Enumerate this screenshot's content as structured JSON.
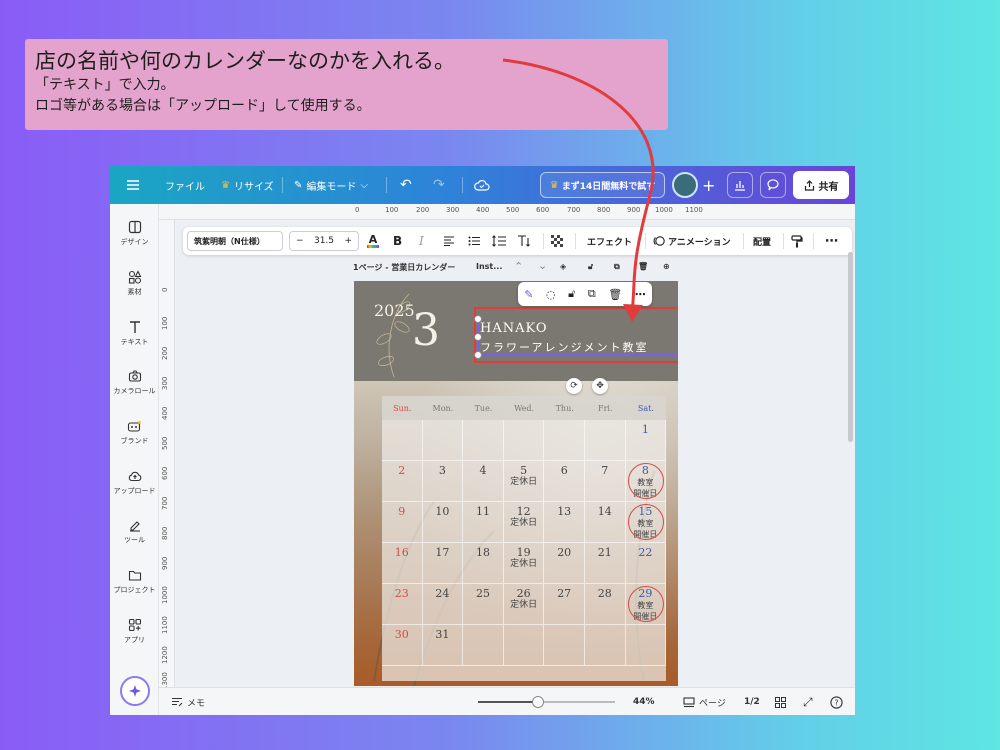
{
  "note": {
    "line1": "店の名前や何のカレンダーなのかを入れる。",
    "line2": "「テキスト」で入力。",
    "line3": "ロゴ等がある場合は「アップロード」して使用する。"
  },
  "topbar": {
    "file": "ファイル",
    "resize": "リサイズ",
    "edit_mode": "編集モード",
    "trial": "まず14日間無料で試す",
    "share": "共有"
  },
  "sidebar": {
    "items": [
      {
        "label": "デザイン",
        "icon": "design-icon"
      },
      {
        "label": "素材",
        "icon": "elements-icon"
      },
      {
        "label": "テキスト",
        "icon": "text-icon"
      },
      {
        "label": "カメラロール",
        "icon": "camera-icon"
      },
      {
        "label": "ブランド",
        "icon": "brand-icon"
      },
      {
        "label": "アップロード",
        "icon": "upload-icon"
      },
      {
        "label": "ツール",
        "icon": "draw-icon"
      },
      {
        "label": "プロジェクト",
        "icon": "folder-icon"
      },
      {
        "label": "アプリ",
        "icon": "apps-icon"
      }
    ]
  },
  "ruler": {
    "top": [
      "0",
      "100",
      "200",
      "300",
      "400",
      "500",
      "600",
      "700",
      "800",
      "900",
      "1000",
      "1100"
    ],
    "left": [
      "0",
      "100",
      "200",
      "300",
      "400",
      "500",
      "600",
      "700",
      "800",
      "900",
      "1000",
      "1100",
      "1200",
      "1300"
    ]
  },
  "text_toolbar": {
    "font": "筑紫明朝（N仕様）",
    "size": "31.5",
    "effect": "エフェクト",
    "animation": "アニメーション",
    "arrange": "配置"
  },
  "pagebar": {
    "title": "1ページ - 営業日カレンダー",
    "suffix": "Inst..."
  },
  "calendar": {
    "year": "2025",
    "month": "3",
    "shop_name": "HANAKO",
    "shop_desc": "フラワーアレンジメント教室",
    "weekdays": [
      "Sun.",
      "Mon.",
      "Tue.",
      "Wed.",
      "Thu.",
      "Fri.",
      "Sat."
    ],
    "weeks": [
      [
        {
          "d": ""
        },
        {
          "d": ""
        },
        {
          "d": ""
        },
        {
          "d": ""
        },
        {
          "d": ""
        },
        {
          "d": ""
        },
        {
          "d": "1"
        }
      ],
      [
        {
          "d": "2"
        },
        {
          "d": "3"
        },
        {
          "d": "4"
        },
        {
          "d": "5",
          "note": "定休日"
        },
        {
          "d": "6"
        },
        {
          "d": "7"
        },
        {
          "d": "8",
          "note": "教室",
          "note2": "開催日",
          "circle": true
        }
      ],
      [
        {
          "d": "9"
        },
        {
          "d": "10"
        },
        {
          "d": "11"
        },
        {
          "d": "12",
          "note": "定休日"
        },
        {
          "d": "13"
        },
        {
          "d": "14"
        },
        {
          "d": "15",
          "note": "教室",
          "note2": "開催日",
          "circle": true
        }
      ],
      [
        {
          "d": "16"
        },
        {
          "d": "17"
        },
        {
          "d": "18"
        },
        {
          "d": "19",
          "note": "定休日"
        },
        {
          "d": "20"
        },
        {
          "d": "21"
        },
        {
          "d": "22"
        }
      ],
      [
        {
          "d": "23"
        },
        {
          "d": "24"
        },
        {
          "d": "25"
        },
        {
          "d": "26",
          "note": "定休日"
        },
        {
          "d": "27"
        },
        {
          "d": "28"
        },
        {
          "d": "29",
          "note": "教室",
          "note2": "開催日",
          "circle": true
        }
      ],
      [
        {
          "d": "30"
        },
        {
          "d": "31"
        },
        {
          "d": ""
        },
        {
          "d": ""
        },
        {
          "d": ""
        },
        {
          "d": ""
        },
        {
          "d": ""
        }
      ]
    ]
  },
  "bottombar": {
    "memo": "メモ",
    "zoom": "44%",
    "zoom_fraction": 0.44,
    "pages_label": "ページ",
    "page_count": "1/2"
  },
  "colors": {
    "annotation_red": "#e23b3b",
    "sunday": "#d24b4b",
    "saturday": "#3b5aa8"
  }
}
